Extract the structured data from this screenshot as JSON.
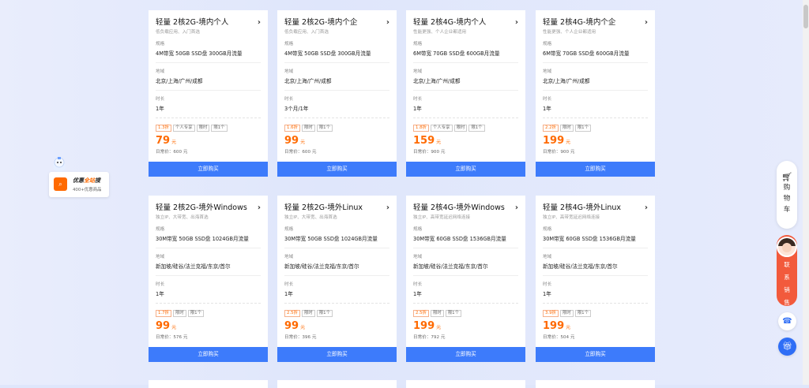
{
  "cards": [
    {
      "title": "轻量 2核2G-境内个人",
      "subtitle": "低负载应用、入门首选",
      "spec_label": "规格",
      "spec": "4M带宽 50GB SSD盘 300GB月流量",
      "region_label": "地域",
      "region": "北京/上海/广州/成都",
      "duration_label": "时长",
      "duration": "1年",
      "tags": [
        "1.3折",
        "个人专享",
        "限时",
        "限1个"
      ],
      "price": "79",
      "unit": "元",
      "original": "日常价：600 元",
      "buy": "立即购买"
    },
    {
      "title": "轻量 2核2G-境内个企",
      "subtitle": "低负载应用、入门首选",
      "spec_label": "规格",
      "spec": "4M带宽 50GB SSD盘 300GB月流量",
      "region_label": "地域",
      "region": "北京/上海/广州/成都",
      "duration_label": "时长",
      "duration": "3个月/1年",
      "tags": [
        "1.6折",
        "限时",
        "限1个"
      ],
      "price": "99",
      "unit": "元",
      "original": "日常价：600 元",
      "buy": "立即购买"
    },
    {
      "title": "轻量 2核4G-境内个人",
      "subtitle": "性能更强、个人企业都适用",
      "spec_label": "规格",
      "spec": "6M带宽 70GB SSD盘 600GB月流量",
      "region_label": "地域",
      "region": "北京/上海/广州/成都",
      "duration_label": "时长",
      "duration": "1年",
      "tags": [
        "1.8折",
        "个人专享",
        "限时",
        "限1个"
      ],
      "price": "159",
      "unit": "元",
      "original": "日常价：900 元",
      "buy": "立即购买"
    },
    {
      "title": "轻量 2核4G-境内个企",
      "subtitle": "性能更强、个人企业都适用",
      "spec_label": "规格",
      "spec": "6M带宽 70GB SSD盘 600GB月流量",
      "region_label": "地域",
      "region": "北京/上海/广州/成都",
      "duration_label": "时长",
      "duration": "1年",
      "tags": [
        "2.2折",
        "限时",
        "限1个"
      ],
      "price": "199",
      "unit": "元",
      "original": "日常价：900 元",
      "buy": "立即购买"
    },
    {
      "title": "轻量 2核2G-境外Windows",
      "subtitle": "独立IP、大带宽、出海首选",
      "spec_label": "规格",
      "spec": "30M带宽 50GB SSD盘 1024GB月流量",
      "region_label": "地域",
      "region": "新加坡/硅谷/法兰克福/东京/首尔",
      "duration_label": "时长",
      "duration": "1年",
      "tags": [
        "1.7折",
        "限时",
        "限1个"
      ],
      "price": "99",
      "unit": "元",
      "original": "日常价：576 元",
      "buy": "立即购买"
    },
    {
      "title": "轻量 2核2G-境外Linux",
      "subtitle": "独立IP、大带宽、出海首选",
      "spec_label": "规格",
      "spec": "30M带宽 50GB SSD盘 1024GB月流量",
      "region_label": "地域",
      "region": "新加坡/硅谷/法兰克福/东京/首尔",
      "duration_label": "时长",
      "duration": "1年",
      "tags": [
        "2.5折",
        "限时",
        "限1个"
      ],
      "price": "99",
      "unit": "元",
      "original": "日常价：396 元",
      "buy": "立即购买"
    },
    {
      "title": "轻量 2核4G-境外Windows",
      "subtitle": "独立IP、高带宽延迟网络连接",
      "spec_label": "规格",
      "spec": "30M带宽 60GB SSD盘 1536GB月流量",
      "region_label": "地域",
      "region": "新加坡/硅谷/法兰克福/东京/首尔",
      "duration_label": "时长",
      "duration": "1年",
      "tags": [
        "2.5折",
        "限时",
        "限1个"
      ],
      "price": "199",
      "unit": "元",
      "original": "日常价：792 元",
      "buy": "立即购买"
    },
    {
      "title": "轻量 2核4G-境外Linux",
      "subtitle": "独立IP、高带宽延迟网络连接",
      "spec_label": "规格",
      "spec": "30M带宽 60GB SSD盘 1536GB月流量",
      "region_label": "地域",
      "region": "新加坡/硅谷/法兰克福/东京/首尔",
      "duration_label": "时长",
      "duration": "1年",
      "tags": [
        "3.9折",
        "限时",
        "限1个"
      ],
      "price": "199",
      "unit": "元",
      "original": "日常价：504 元",
      "buy": "立即购买"
    }
  ],
  "left_float": {
    "title_prefix": "优惠",
    "title_highlight": "全站",
    "title_suffix": "搜",
    "sub": "400+优惠商品"
  },
  "right_float": {
    "cart_label": [
      "购",
      "物",
      "车"
    ],
    "sales_label": [
      "联",
      "系",
      "销",
      "售"
    ]
  },
  "colors": {
    "accent": "#ff6a00",
    "button": "#3d7bfb",
    "sales": "#f25a3c"
  }
}
